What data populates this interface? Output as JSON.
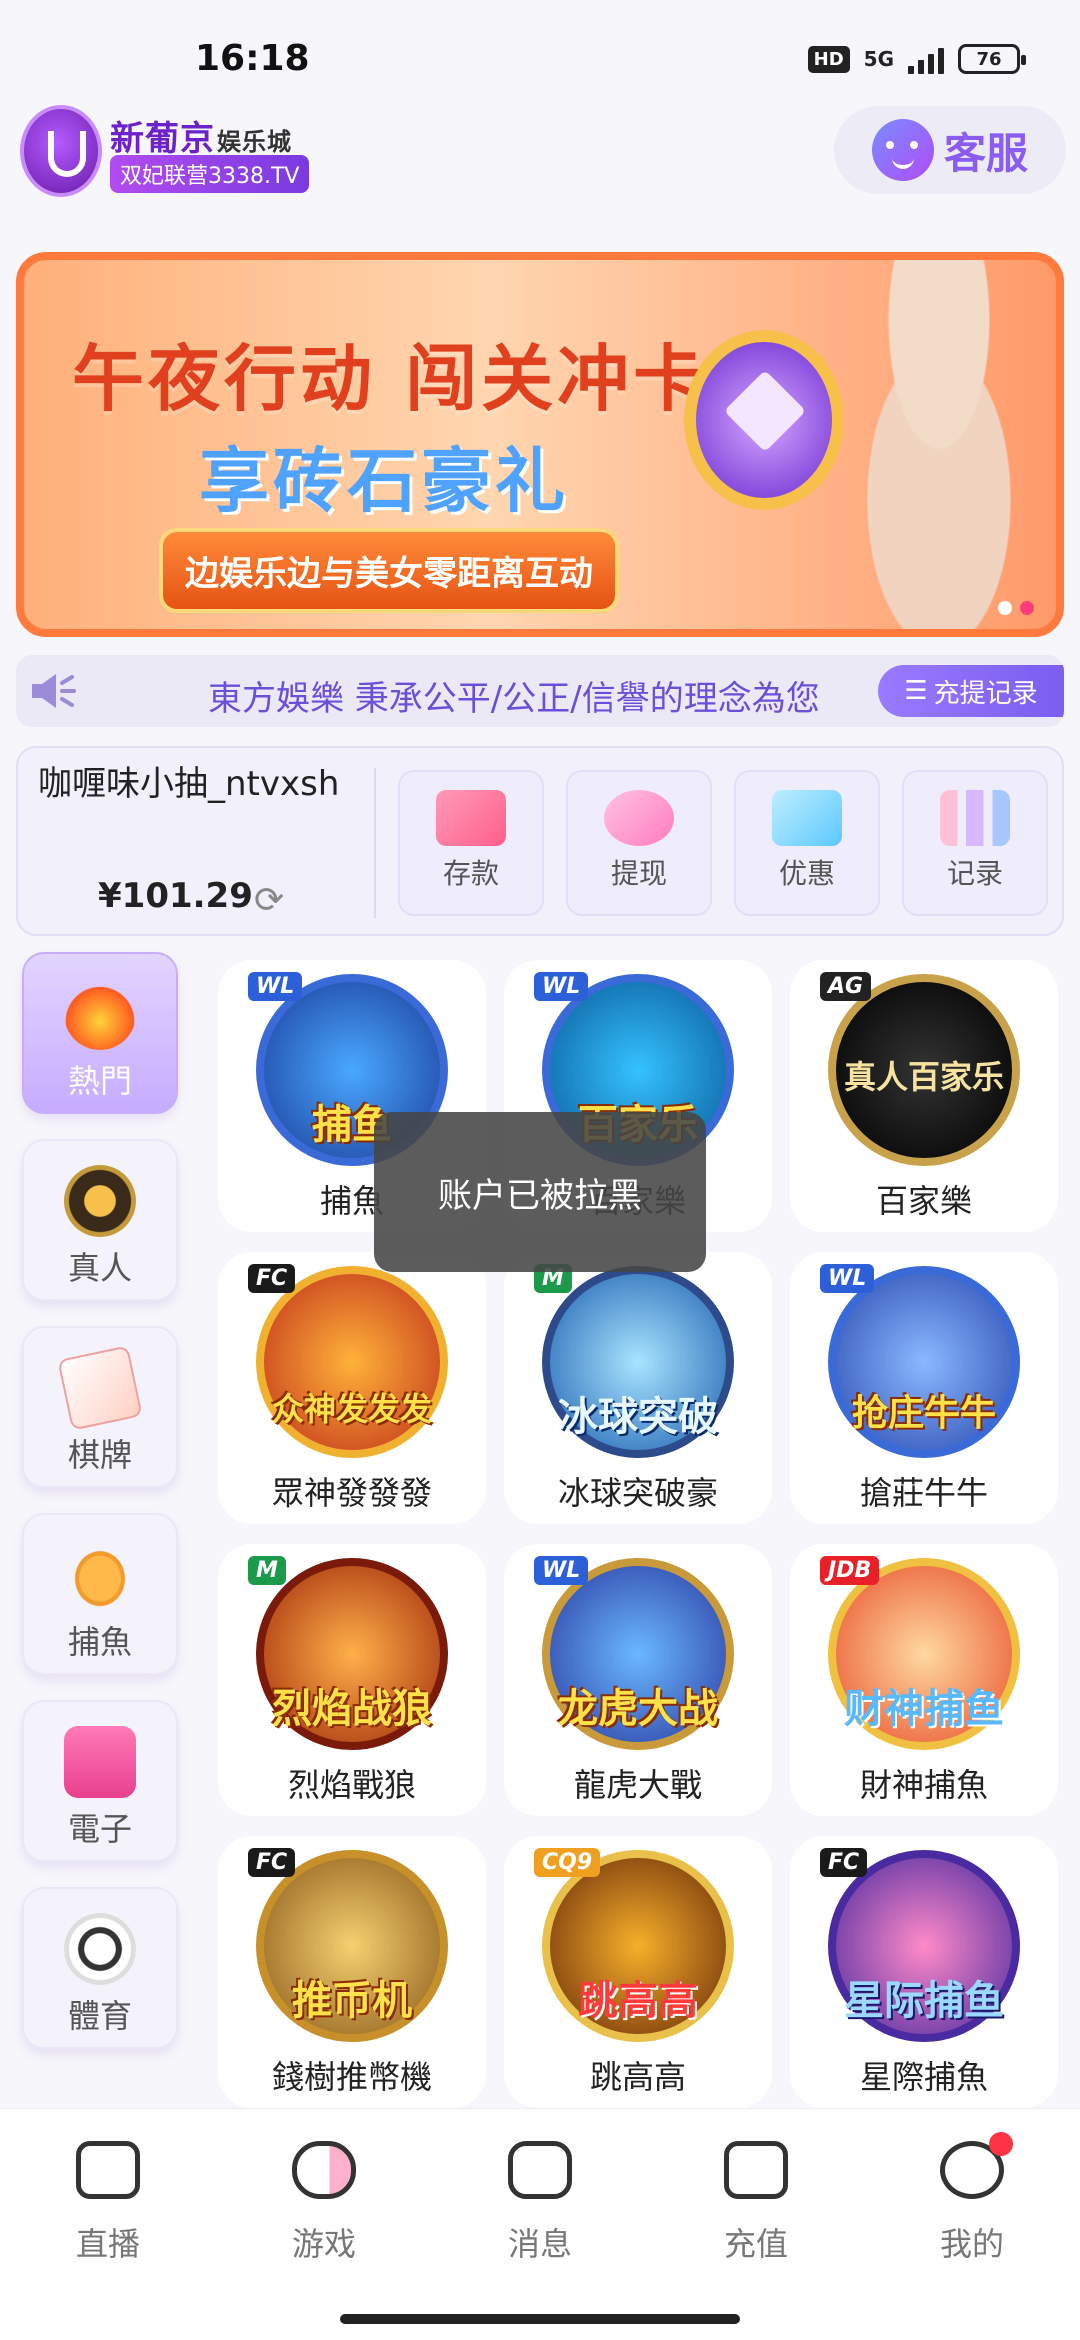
{
  "status": {
    "time": "16:18",
    "hd": "HD",
    "network": "5G",
    "battery": "76"
  },
  "header": {
    "logo_title": "新葡京",
    "logo_suffix": "娱乐城",
    "logo_slogan": "双妃联营3338.TV",
    "service_label": "客服"
  },
  "banner": {
    "line1": "午夜行动 闯关冲卡",
    "line2": "享砖石豪礼",
    "line3": "边娱乐边与美女零距离互动"
  },
  "marquee": {
    "text": "東方娛樂 秉承公平/公正/信譽的理念為您",
    "button_label": "充提记录"
  },
  "account": {
    "username": "咖喱味小抽_ntvxsh",
    "balance": "¥101.29",
    "actions": [
      {
        "label": "存款",
        "color": "#ff7aa0"
      },
      {
        "label": "提现",
        "color": "#ff9fd0"
      },
      {
        "label": "优惠",
        "color": "#7ad6ff"
      },
      {
        "label": "记录",
        "color": "#b08cff"
      }
    ]
  },
  "categories": [
    {
      "label": "熱門",
      "active": true
    },
    {
      "label": "真人",
      "active": false
    },
    {
      "label": "棋牌",
      "active": false
    },
    {
      "label": "捕魚",
      "active": false
    },
    {
      "label": "電子",
      "active": false
    },
    {
      "label": "體育",
      "active": false
    }
  ],
  "games": [
    {
      "label": "捕魚",
      "art": "捕鱼",
      "tag": "WL"
    },
    {
      "label": "百家樂",
      "art": "百家乐",
      "tag": "WL"
    },
    {
      "label": "百家樂",
      "art": "真人百家乐",
      "tag": "AG"
    },
    {
      "label": "眾神發發發",
      "art": "众神发发发",
      "tag": "FC"
    },
    {
      "label": "冰球突破豪",
      "art": "冰球突破",
      "tag": "M"
    },
    {
      "label": "搶莊牛牛",
      "art": "抢庄牛牛",
      "tag": "WL"
    },
    {
      "label": "烈焰戰狼",
      "art": "烈焰战狼",
      "tag": "M"
    },
    {
      "label": "龍虎大戰",
      "art": "龙虎大战",
      "tag": "WL"
    },
    {
      "label": "財神捕魚",
      "art": "财神捕鱼",
      "tag": "JDB"
    },
    {
      "label": "錢樹推幣機",
      "art": "推币机",
      "tag": "FC"
    },
    {
      "label": "跳高高",
      "art": "跳高高",
      "tag": "CQ9"
    },
    {
      "label": "星際捕魚",
      "art": "星际捕鱼",
      "tag": "FC"
    }
  ],
  "toast": "账户已被拉黑",
  "bottom_nav": [
    {
      "label": "直播",
      "icon": "video-icon"
    },
    {
      "label": "游戏",
      "icon": "gamepad-icon"
    },
    {
      "label": "消息",
      "icon": "message-icon"
    },
    {
      "label": "充值",
      "icon": "wallet-icon"
    },
    {
      "label": "我的",
      "icon": "profile-icon"
    }
  ]
}
